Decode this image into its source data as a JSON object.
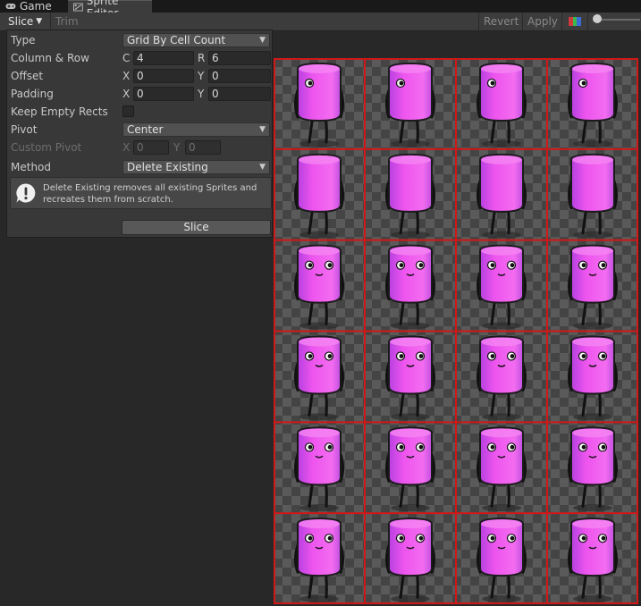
{
  "tabs": [
    {
      "label": "Game",
      "icon": "gamepad-icon"
    },
    {
      "label": "Sprite Editor",
      "icon": "sprite-editor-icon"
    }
  ],
  "toolbar": {
    "slice_label": "Slice",
    "trim_label": "Trim",
    "revert_label": "Revert",
    "apply_label": "Apply"
  },
  "panel": {
    "type_label": "Type",
    "type_value": "Grid By Cell Count",
    "column_row_label": "Column & Row",
    "c_axis": "C",
    "r_axis": "R",
    "columns": "4",
    "rows": "6",
    "offset_label": "Offset",
    "offset_x": "0",
    "offset_y": "0",
    "padding_label": "Padding",
    "padding_x": "0",
    "padding_y": "0",
    "x_axis": "X",
    "y_axis": "Y",
    "keep_empty_label": "Keep Empty Rects",
    "keep_empty_checked": false,
    "pivot_label": "Pivot",
    "pivot_value": "Center",
    "custom_pivot_label": "Custom Pivot",
    "custom_pivot_x": "0",
    "custom_pivot_y": "0",
    "method_label": "Method",
    "method_value": "Delete Existing",
    "help_text": "Delete Existing removes all existing Sprites and recreates them from scratch.",
    "slice_button": "Slice"
  },
  "sheet": {
    "columns": 4,
    "rows": 6,
    "grid_color": "#d01818",
    "character_color": "#ee55ee"
  }
}
